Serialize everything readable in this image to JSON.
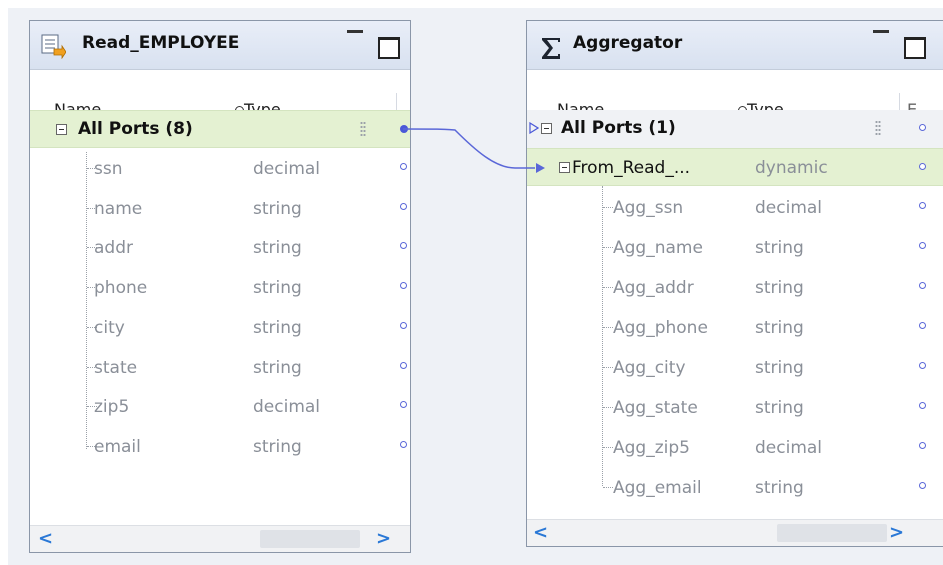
{
  "read_employee": {
    "title": "Read_EMPLOYEE",
    "columns": {
      "name": "Name",
      "type": "Type"
    },
    "group_label": "All Ports (8)",
    "ports": [
      {
        "name": "ssn",
        "type": "decimal"
      },
      {
        "name": "name",
        "type": "string"
      },
      {
        "name": "addr",
        "type": "string"
      },
      {
        "name": "phone",
        "type": "string"
      },
      {
        "name": "city",
        "type": "string"
      },
      {
        "name": "state",
        "type": "string"
      },
      {
        "name": "zip5",
        "type": "decimal"
      },
      {
        "name": "email",
        "type": "string"
      }
    ],
    "scroll_left": "<",
    "scroll_right": ">"
  },
  "aggregator": {
    "title": "Aggregator",
    "columns": {
      "name": "Name",
      "type": "Type",
      "third": "E"
    },
    "group_label": "All Ports (1)",
    "dynamic_port": {
      "name": "From_Read_...",
      "type": "dynamic"
    },
    "ports": [
      {
        "name": "Agg_ssn",
        "type": "decimal"
      },
      {
        "name": "Agg_name",
        "type": "string"
      },
      {
        "name": "Agg_addr",
        "type": "string"
      },
      {
        "name": "Agg_phone",
        "type": "string"
      },
      {
        "name": "Agg_city",
        "type": "string"
      },
      {
        "name": "Agg_state",
        "type": "string"
      },
      {
        "name": "Agg_zip5",
        "type": "decimal"
      },
      {
        "name": "Agg_email",
        "type": "string"
      }
    ],
    "scroll_left": "<",
    "scroll_right": ">"
  },
  "colors": {
    "group_row": "#e4f1d2",
    "port_link": "#4a58d8",
    "muted_text": "#8a8f98"
  }
}
